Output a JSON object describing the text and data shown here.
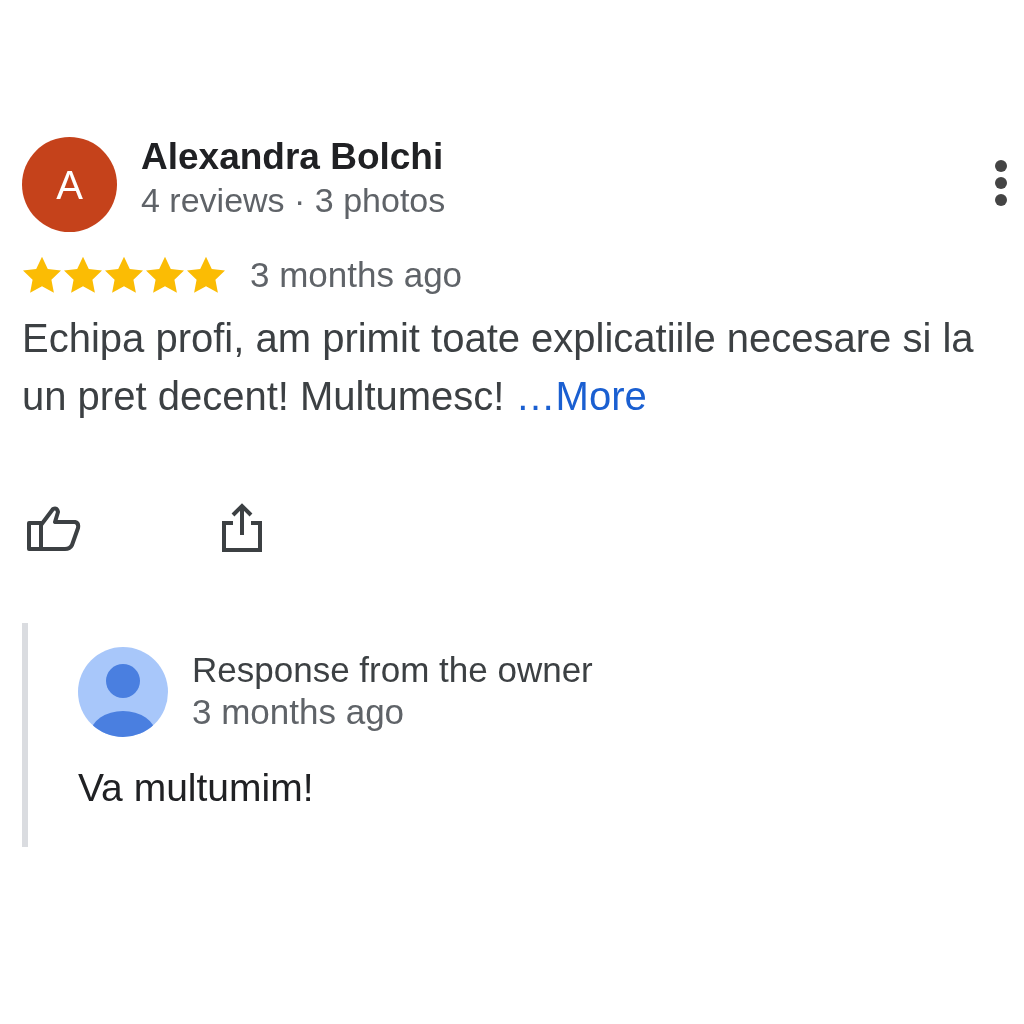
{
  "review": {
    "avatar_letter": "A",
    "author": "Alexandra Bolchi",
    "meta": "4 reviews · 3 photos",
    "stars": 5,
    "time": "3 months ago",
    "text": "Echipa profi, am primit toate explicatiile necesare si la un pret decent! Multumesc! ",
    "more": "…More"
  },
  "reply": {
    "title": "Response from the owner",
    "time": "3 months ago",
    "text": "Va multumim!"
  }
}
